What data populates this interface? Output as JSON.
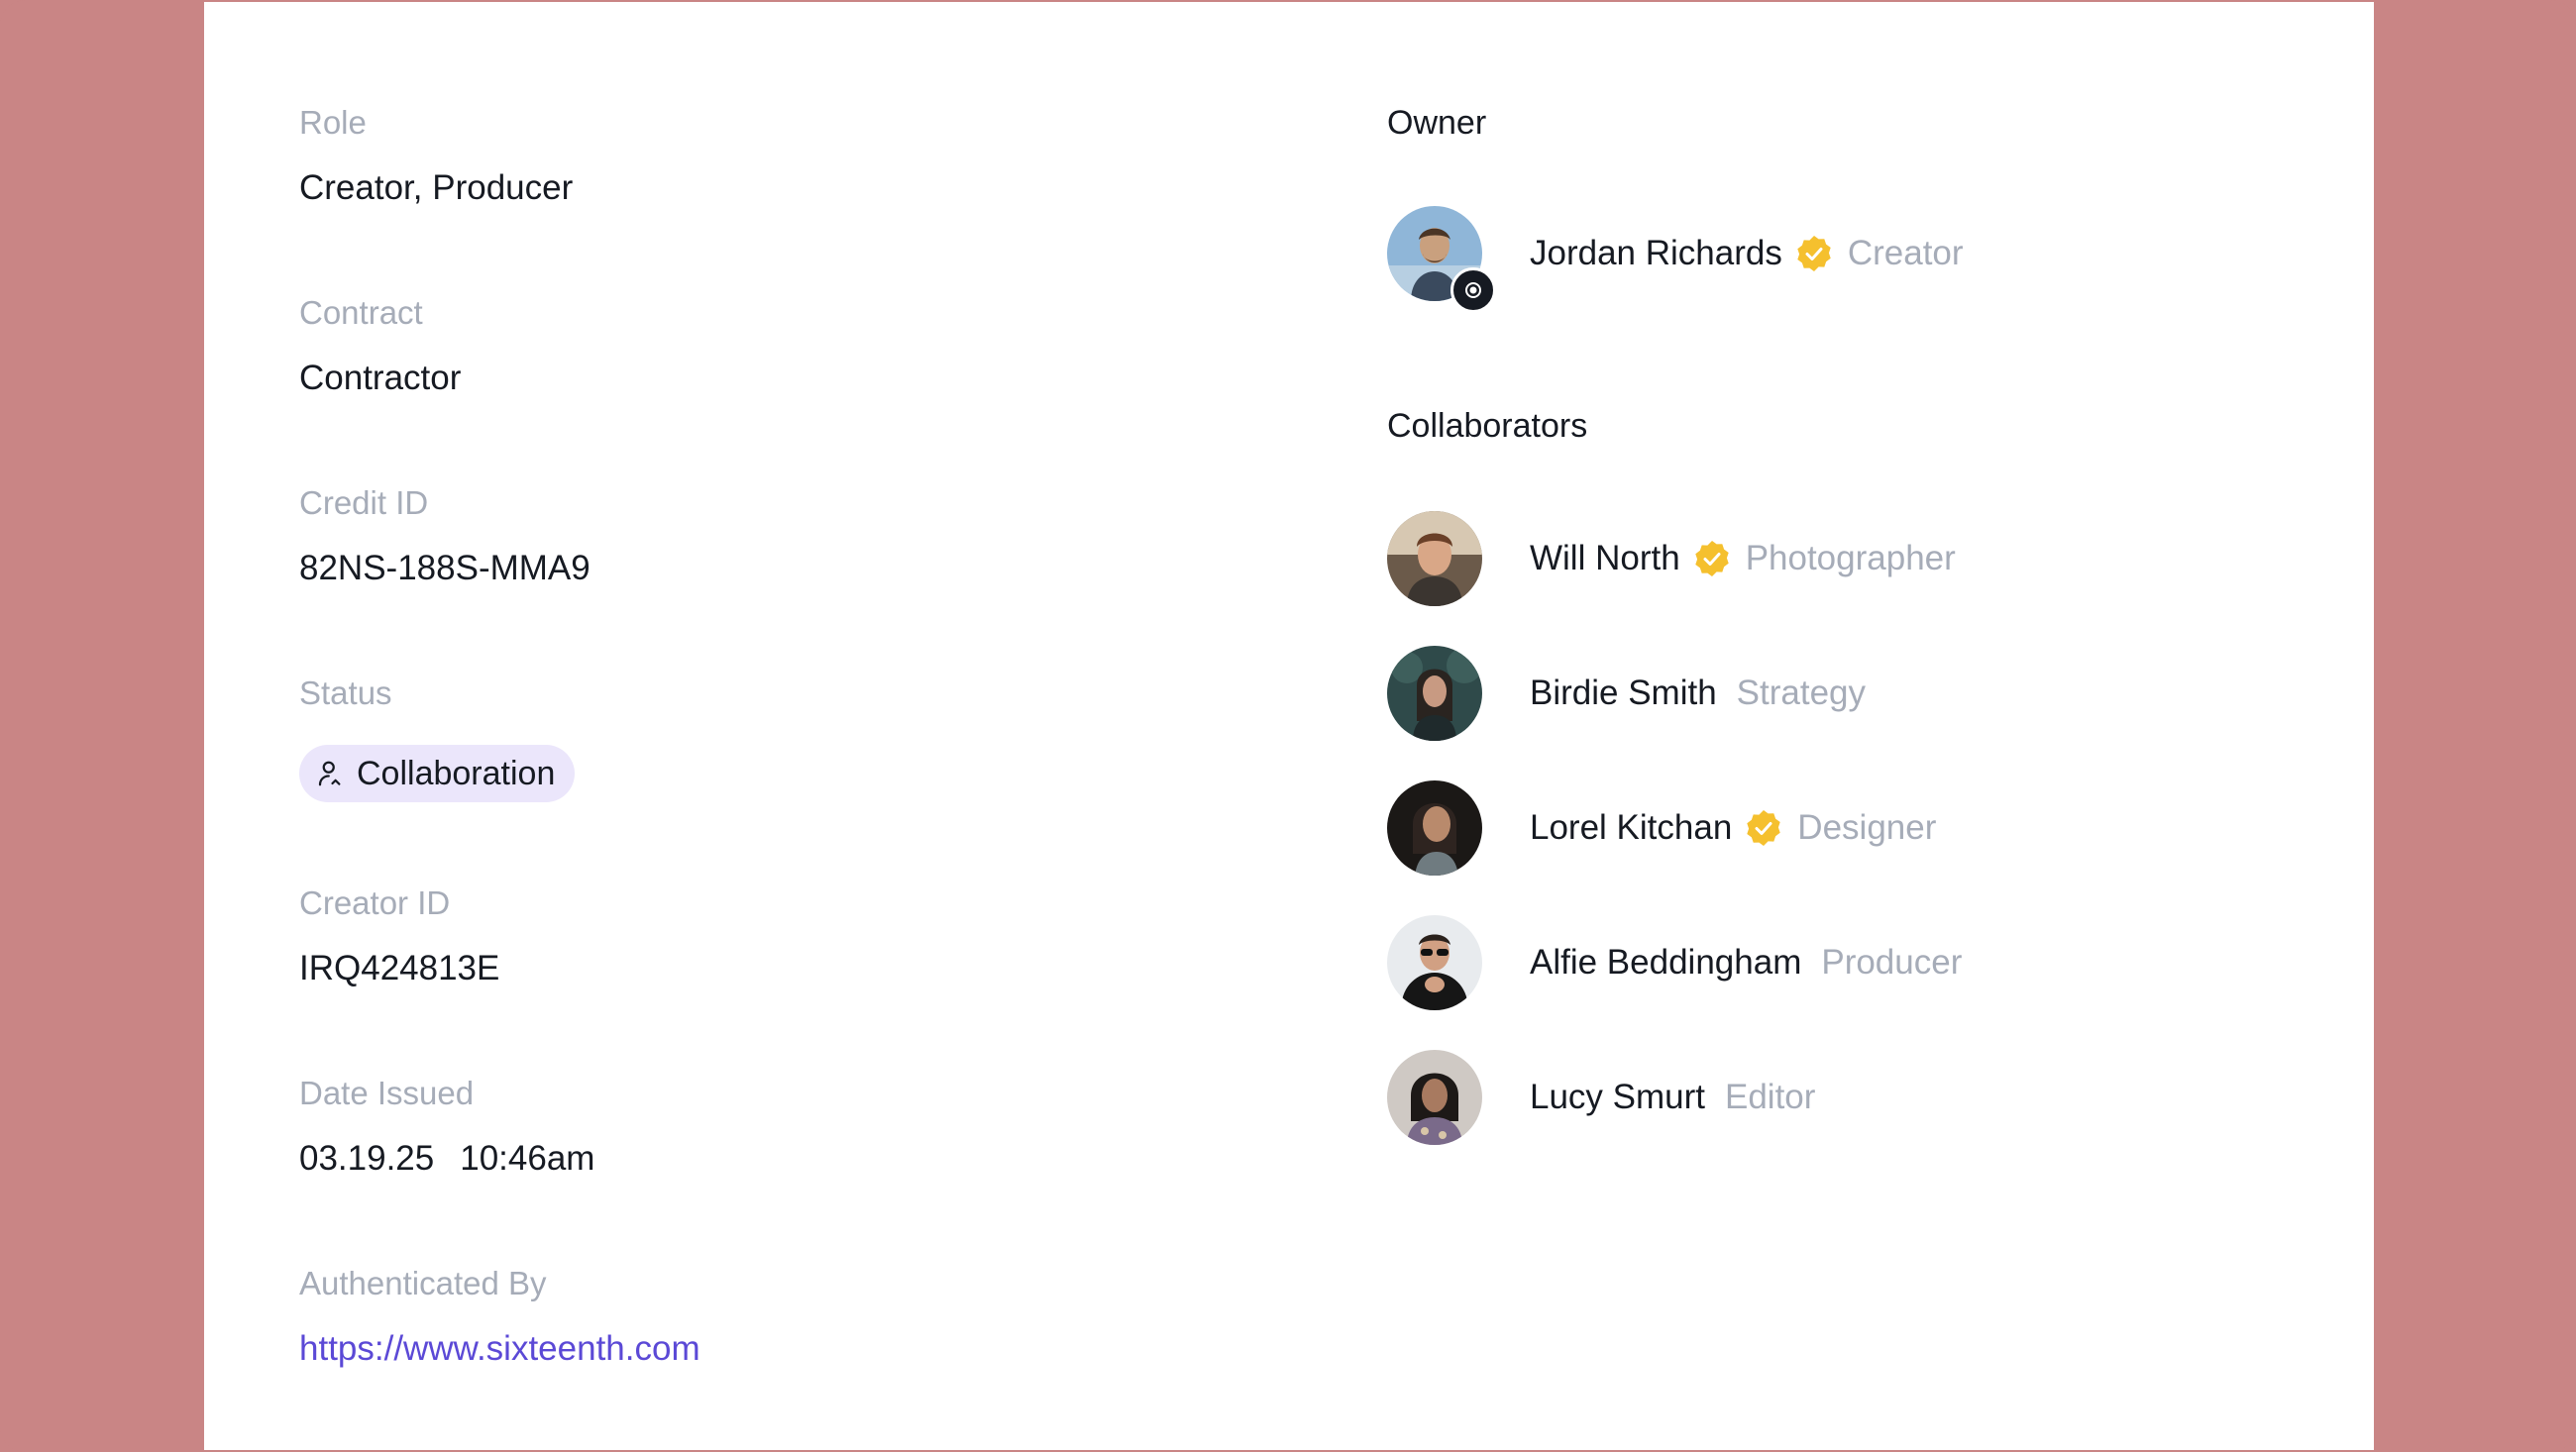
{
  "details": {
    "role": {
      "label": "Role",
      "value": "Creator, Producer"
    },
    "contract": {
      "label": "Contract",
      "value": "Contractor"
    },
    "credit_id": {
      "label": "Credit ID",
      "value": "82NS-188S-MMA9"
    },
    "status": {
      "label": "Status",
      "value": "Collaboration",
      "icon": "user-icon"
    },
    "creator_id": {
      "label": "Creator ID",
      "value": "IRQ424813E"
    },
    "date_issued": {
      "label": "Date Issued",
      "date": "03.19.25",
      "time": "10:46am"
    },
    "authenticated_by": {
      "label": "Authenticated By",
      "value": "https://www.sixteenth.com"
    }
  },
  "owner": {
    "title": "Owner",
    "name": "Jordan Richards",
    "role": "Creator",
    "verified": true,
    "badge_icon": "eye-icon"
  },
  "collaborators": {
    "title": "Collaborators",
    "items": [
      {
        "name": "Will North",
        "role": "Photographer",
        "verified": true
      },
      {
        "name": "Birdie Smith",
        "role": "Strategy",
        "verified": false
      },
      {
        "name": "Lorel Kitchan",
        "role": "Designer",
        "verified": true
      },
      {
        "name": "Alfie Beddingham",
        "role": "Producer",
        "verified": false
      },
      {
        "name": "Lucy Smurt",
        "role": "Editor",
        "verified": false
      }
    ]
  },
  "colors": {
    "background": "#c98585",
    "card": "#ffffff",
    "text": "#161a22",
    "muted": "#a6acb8",
    "link": "#5b49d6",
    "badge_bg": "#ebe6fb",
    "verified": "#f5c02e"
  }
}
